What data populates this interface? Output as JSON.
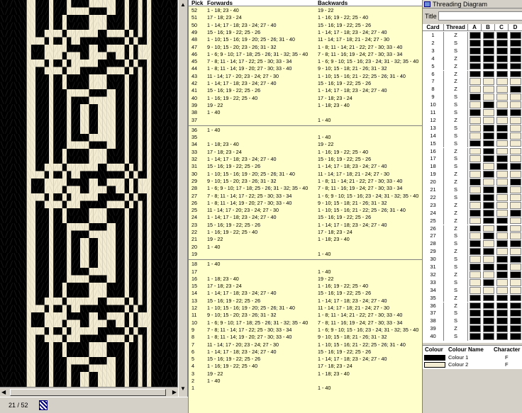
{
  "pattern": {
    "cards": 40,
    "picks": 52
  },
  "status": {
    "position": "21 / 52"
  },
  "table": {
    "headers": {
      "pick": "Pick",
      "forwards": "Forwards",
      "backwards": "Backwards"
    },
    "rows": [
      {
        "pick": "52",
        "fw": "1 - 18; 23 - 40",
        "bw": "19 - 22"
      },
      {
        "pick": "51",
        "fw": "17 - 18; 23 - 24",
        "bw": "1 - 16; 19 - 22; 25 - 40"
      },
      {
        "pick": "50",
        "fw": "1 - 14; 17 - 18; 23 - 24; 27 - 40",
        "bw": "15 - 16; 19 - 22; 25 - 26"
      },
      {
        "pick": "49",
        "fw": "15 - 16; 19 - 22; 25 - 26",
        "bw": "1 - 14; 17 - 18; 23 - 24; 27 - 40"
      },
      {
        "pick": "48",
        "fw": "1 - 10; 15 - 16; 19 - 20; 25 - 26; 31 - 40",
        "bw": "11 - 14; 17 - 18; 21 - 24; 27 - 30"
      },
      {
        "pick": "47",
        "fw": "9 - 10; 15 - 20; 23 - 26; 31 - 32",
        "bw": "1 - 8; 11 - 14; 21 - 22; 27 - 30; 33 - 40"
      },
      {
        "pick": "46",
        "fw": "1 - 6; 9 - 10; 17 - 18; 25 - 26; 31 - 32; 35 - 40",
        "bw": "7 - 8; 11 - 16; 19 - 24; 27 - 30; 33 - 34"
      },
      {
        "pick": "45",
        "fw": "7 - 8; 11 - 14; 17 - 22; 25 - 30; 33 - 34",
        "bw": "1 - 6; 9 - 10; 15 - 16; 23 - 24; 31 - 32; 35 - 40"
      },
      {
        "pick": "44",
        "fw": "1 - 8; 11 - 14; 19 - 20; 27 - 30; 33 - 40",
        "bw": "9 - 10; 15 - 18; 21 - 26; 31 - 32"
      },
      {
        "pick": "43",
        "fw": "11 - 14; 17 - 20; 23 - 24; 27 - 30",
        "bw": "1 - 10; 15 - 16; 21 - 22; 25 - 26; 31 - 40"
      },
      {
        "pick": "42",
        "fw": "1 - 14; 17 - 18; 23 - 24; 27 - 40",
        "bw": "15 - 16; 19 - 22; 25 - 26"
      },
      {
        "pick": "41",
        "fw": "15 - 16; 19 - 22; 25 - 26",
        "bw": "1 - 14; 17 - 18; 23 - 24; 27 - 40"
      },
      {
        "pick": "40",
        "fw": "1 - 16; 19 - 22; 25 - 40",
        "bw": "17 - 18; 23 - 24"
      },
      {
        "pick": "39",
        "fw": "19 - 22",
        "bw": "1 - 18; 23 - 40"
      },
      {
        "pick": "38",
        "fw": "1 - 40",
        "bw": ""
      },
      {
        "pick": "37",
        "fw": "",
        "bw": "1 - 40"
      },
      {
        "pick": "36",
        "fw": "1 - 40",
        "bw": ""
      },
      {
        "pick": "35",
        "fw": "",
        "bw": "1 - 40"
      },
      {
        "pick": "34",
        "fw": "1 - 18; 23 - 40",
        "bw": "19 - 22"
      },
      {
        "pick": "33",
        "fw": "17 - 18; 23 - 24",
        "bw": "1 - 16; 19 - 22; 25 - 40"
      },
      {
        "pick": "32",
        "fw": "1 - 14; 17 - 18; 23 - 24; 27 - 40",
        "bw": "15 - 16; 19 - 22; 25 - 26"
      },
      {
        "pick": "31",
        "fw": "15 - 16; 19 - 22; 25 - 26",
        "bw": "1 - 14; 17 - 18; 23 - 24; 27 - 40"
      },
      {
        "pick": "30",
        "fw": "1 - 10; 15 - 16; 19 - 20; 25 - 26; 31 - 40",
        "bw": "11 - 14; 17 - 18; 21 - 24; 27 - 30"
      },
      {
        "pick": "29",
        "fw": "9 - 10; 15 - 20; 23 - 26; 31 - 32",
        "bw": "1 - 8; 11 - 14; 21 - 22; 27 - 30; 33 - 40"
      },
      {
        "pick": "28",
        "fw": "1 - 6; 9 - 10; 17 - 18; 25 - 26; 31 - 32; 35 - 40",
        "bw": "7 - 8; 11 - 16; 19 - 24; 27 - 30; 33 - 34"
      },
      {
        "pick": "27",
        "fw": "7 - 8; 11 - 14; 17 - 22; 25 - 30; 33 - 34",
        "bw": "1 - 6; 9 - 10; 15 - 16; 23 - 24; 31 - 32; 35 - 40"
      },
      {
        "pick": "26",
        "fw": "1 - 8; 11 - 14; 19 - 20; 27 - 30; 33 - 40",
        "bw": "9 - 10; 15 - 18; 21 - 26; 31 - 32"
      },
      {
        "pick": "25",
        "fw": "11 - 14; 17 - 20; 23 - 24; 27 - 30",
        "bw": "1 - 10; 15 - 16; 21 - 22; 25 - 26; 31 - 40"
      },
      {
        "pick": "24",
        "fw": "1 - 14; 17 - 18; 23 - 24; 27 - 40",
        "bw": "15 - 16; 19 - 22; 25 - 26"
      },
      {
        "pick": "23",
        "fw": "15 - 16; 19 - 22; 25 - 26",
        "bw": "1 - 14; 17 - 18; 23 - 24; 27 - 40"
      },
      {
        "pick": "22",
        "fw": "1 - 16; 19 - 22; 25 - 40",
        "bw": "17 - 18; 23 - 24"
      },
      {
        "pick": "21",
        "fw": "19 - 22",
        "bw": "1 - 18; 23 - 40"
      },
      {
        "pick": "20",
        "fw": "1 - 40",
        "bw": ""
      },
      {
        "pick": "19",
        "fw": "",
        "bw": "1 - 40"
      },
      {
        "pick": "18",
        "fw": "1 - 40",
        "bw": ""
      },
      {
        "pick": "17",
        "fw": "",
        "bw": "1 - 40"
      },
      {
        "pick": "16",
        "fw": "1 - 18; 23 - 40",
        "bw": "19 - 22"
      },
      {
        "pick": "15",
        "fw": "17 - 18; 23 - 24",
        "bw": "1 - 16; 19 - 22; 25 - 40"
      },
      {
        "pick": "14",
        "fw": "1 - 14; 17 - 18; 23 - 24; 27 - 40",
        "bw": "15 - 16; 19 - 22; 25 - 26"
      },
      {
        "pick": "13",
        "fw": "15 - 16; 19 - 22; 25 - 26",
        "bw": "1 - 14; 17 - 18; 23 - 24; 27 - 40"
      },
      {
        "pick": "12",
        "fw": "1 - 10; 15 - 16; 19 - 20; 25 - 26; 31 - 40",
        "bw": "11 - 14; 17 - 18; 21 - 24; 27 - 30"
      },
      {
        "pick": "11",
        "fw": "9 - 10; 15 - 20; 23 - 26; 31 - 32",
        "bw": "1 - 8; 11 - 14; 21 - 22; 27 - 30; 33 - 40"
      },
      {
        "pick": "10",
        "fw": "1 - 6; 9 - 10; 17 - 18; 25 - 26; 31 - 32; 35 - 40",
        "bw": "7 - 8; 11 - 16; 19 - 24; 27 - 30; 33 - 34"
      },
      {
        "pick": "9",
        "fw": "7 - 8; 11 - 14; 17 - 22; 25 - 30; 33 - 34",
        "bw": "1 - 6; 9 - 10; 15 - 16; 23 - 24; 31 - 32; 35 - 40"
      },
      {
        "pick": "8",
        "fw": "1 - 8; 11 - 14; 19 - 20; 27 - 30; 33 - 40",
        "bw": "9 - 10; 15 - 18; 21 - 26; 31 - 32"
      },
      {
        "pick": "7",
        "fw": "11 - 14; 17 - 20; 23 - 24; 27 - 30",
        "bw": "1 - 10; 15 - 16; 21 - 22; 25 - 26; 31 - 40"
      },
      {
        "pick": "6",
        "fw": "1 - 14; 17 - 18; 23 - 24; 27 - 40",
        "bw": "15 - 16; 19 - 22; 25 - 26"
      },
      {
        "pick": "5",
        "fw": "15 - 16; 19 - 22; 25 - 26",
        "bw": "1 - 14; 17 - 18; 23 - 24; 27 - 40"
      },
      {
        "pick": "4",
        "fw": "1 - 16; 19 - 22; 25 - 40",
        "bw": "17 - 18; 23 - 24"
      },
      {
        "pick": "3",
        "fw": "19 - 22",
        "bw": "1 - 18; 23 - 40"
      },
      {
        "pick": "2",
        "fw": "1 - 40",
        "bw": ""
      },
      {
        "pick": "1",
        "fw": "",
        "bw": "1 - 40"
      }
    ]
  },
  "threading": {
    "window_title": "Threading Diagram",
    "title_label": "Title",
    "title_value": "",
    "headers": {
      "card": "Card",
      "thread": "Thread",
      "a": "A",
      "b": "B",
      "c": "C",
      "d": "D"
    },
    "colours": {
      "colour1": "#000000",
      "colour2": "#f3ecd3"
    },
    "cards": [
      {
        "n": "1",
        "t": "Z",
        "h": [
          1,
          1,
          1,
          1
        ]
      },
      {
        "n": "2",
        "t": "S",
        "h": [
          1,
          1,
          1,
          1
        ]
      },
      {
        "n": "3",
        "t": "S",
        "h": [
          1,
          1,
          1,
          1
        ]
      },
      {
        "n": "4",
        "t": "Z",
        "h": [
          1,
          1,
          1,
          1
        ]
      },
      {
        "n": "5",
        "t": "Z",
        "h": [
          1,
          1,
          1,
          1
        ]
      },
      {
        "n": "6",
        "t": "Z",
        "h": [
          1,
          1,
          1,
          1
        ]
      },
      {
        "n": "7",
        "t": "Z",
        "h": [
          0,
          0,
          0,
          0
        ]
      },
      {
        "n": "8",
        "t": "Z",
        "h": [
          0,
          0,
          0,
          1
        ]
      },
      {
        "n": "9",
        "t": "S",
        "h": [
          1,
          0,
          0,
          0
        ]
      },
      {
        "n": "10",
        "t": "S",
        "h": [
          0,
          1,
          0,
          0
        ]
      },
      {
        "n": "11",
        "t": "S",
        "h": [
          1,
          0,
          1,
          1
        ]
      },
      {
        "n": "12",
        "t": "Z",
        "h": [
          0,
          0,
          0,
          0
        ]
      },
      {
        "n": "13",
        "t": "S",
        "h": [
          0,
          1,
          1,
          0
        ]
      },
      {
        "n": "14",
        "t": "S",
        "h": [
          0,
          1,
          1,
          0
        ]
      },
      {
        "n": "15",
        "t": "S",
        "h": [
          1,
          1,
          0,
          0
        ]
      },
      {
        "n": "16",
        "t": "Z",
        "h": [
          0,
          1,
          0,
          0
        ]
      },
      {
        "n": "17",
        "t": "S",
        "h": [
          0,
          1,
          1,
          0
        ]
      },
      {
        "n": "18",
        "t": "S",
        "h": [
          1,
          0,
          1,
          1
        ]
      },
      {
        "n": "19",
        "t": "Z",
        "h": [
          0,
          1,
          0,
          0
        ]
      },
      {
        "n": "20",
        "t": "Z",
        "h": [
          1,
          0,
          0,
          1
        ]
      },
      {
        "n": "21",
        "t": "S",
        "h": [
          0,
          1,
          1,
          0
        ]
      },
      {
        "n": "22",
        "t": "S",
        "h": [
          1,
          1,
          0,
          0
        ]
      },
      {
        "n": "23",
        "t": "Z",
        "h": [
          0,
          1,
          0,
          0
        ]
      },
      {
        "n": "24",
        "t": "Z",
        "h": [
          1,
          1,
          0,
          1
        ]
      },
      {
        "n": "25",
        "t": "Z",
        "h": [
          0,
          1,
          1,
          0
        ]
      },
      {
        "n": "26",
        "t": "Z",
        "h": [
          1,
          0,
          1,
          0
        ]
      },
      {
        "n": "27",
        "t": "S",
        "h": [
          0,
          1,
          0,
          0
        ]
      },
      {
        "n": "28",
        "t": "S",
        "h": [
          1,
          0,
          1,
          1
        ]
      },
      {
        "n": "29",
        "t": "Z",
        "h": [
          1,
          1,
          0,
          0
        ]
      },
      {
        "n": "30",
        "t": "S",
        "h": [
          0,
          0,
          1,
          1
        ]
      },
      {
        "n": "31",
        "t": "S",
        "h": [
          1,
          1,
          1,
          0
        ]
      },
      {
        "n": "32",
        "t": "Z",
        "h": [
          0,
          0,
          1,
          1
        ]
      },
      {
        "n": "33",
        "t": "S",
        "h": [
          0,
          1,
          0,
          0
        ]
      },
      {
        "n": "34",
        "t": "S",
        "h": [
          0,
          0,
          0,
          0
        ]
      },
      {
        "n": "35",
        "t": "Z",
        "h": [
          1,
          1,
          1,
          1
        ]
      },
      {
        "n": "36",
        "t": "Z",
        "h": [
          1,
          1,
          1,
          1
        ]
      },
      {
        "n": "37",
        "t": "S",
        "h": [
          1,
          1,
          1,
          1
        ]
      },
      {
        "n": "38",
        "t": "S",
        "h": [
          1,
          1,
          1,
          1
        ]
      },
      {
        "n": "39",
        "t": "Z",
        "h": [
          1,
          1,
          1,
          1
        ]
      },
      {
        "n": "40",
        "t": "S",
        "h": [
          1,
          1,
          1,
          1
        ]
      }
    ],
    "colour_table": {
      "headers": {
        "colour": "Colour",
        "name": "Colour Name",
        "character": "Character"
      },
      "rows": [
        {
          "name": "Colour 1",
          "char": "F",
          "swatch": "#000000"
        },
        {
          "name": "Colour 2",
          "char": "F",
          "swatch": "#f3ecd3"
        }
      ]
    }
  }
}
